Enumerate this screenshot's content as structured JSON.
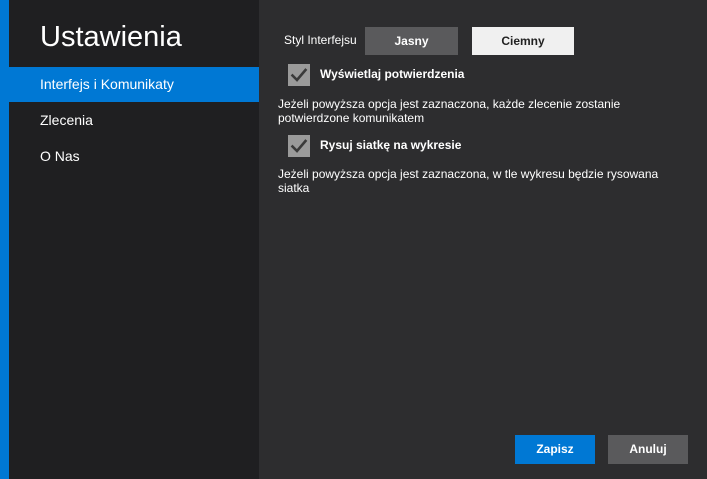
{
  "colors": {
    "accent": "#0078d4",
    "sidebar_bg": "#1f1f21",
    "content_bg": "#2d2d2f",
    "segment_active_bg": "#5a5a5c",
    "segment_inactive_bg": "#f0f0f0",
    "checkbox_bg": "#9a9a9a"
  },
  "sidebar": {
    "title": "Ustawienia",
    "items": [
      {
        "label": "Interfejs i Komunikaty",
        "active": true
      },
      {
        "label": "Zlecenia",
        "active": false
      },
      {
        "label": "O Nas",
        "active": false
      }
    ]
  },
  "interface_style": {
    "label": "Styl Interfejsu",
    "options": [
      "Jasny",
      "Ciemny"
    ],
    "selected": "Jasny"
  },
  "options": [
    {
      "label": "Wyświetlaj potwierdzenia",
      "checked": true,
      "description": "Jeżeli powyższa opcja jest zaznaczona, każde zlecenie zostanie potwierdzone komunikatem",
      "icon": "checkmark-icon"
    },
    {
      "label": "Rysuj siatkę na wykresie",
      "checked": true,
      "description": "Jeżeli powyższa opcja jest zaznaczona, w tle wykresu będzie rysowana siatka",
      "icon": "checkmark-icon"
    }
  ],
  "actions": {
    "save_label": "Zapisz",
    "cancel_label": "Anuluj"
  }
}
